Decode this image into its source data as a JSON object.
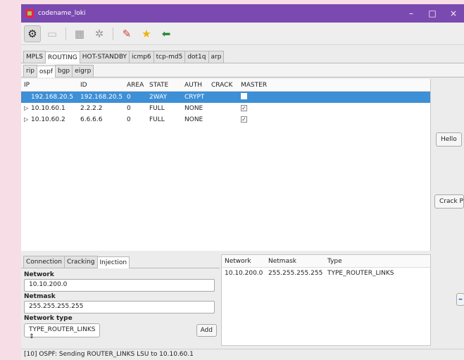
{
  "window": {
    "title": "codename_loki",
    "controls": [
      "–",
      "□",
      "×"
    ]
  },
  "toolbar": {
    "icons": [
      "gear-icon",
      "folder-icon",
      "users-icon",
      "network-icon",
      "edit-icon",
      "star-icon",
      "arrow-icon"
    ]
  },
  "protocol_tabs": [
    "MPLS",
    "ROUTING",
    "HOT-STANDBY",
    "icmp6",
    "tcp-md5",
    "dot1q",
    "arp"
  ],
  "routing_tabs": [
    "rip",
    "ospf",
    "bgp",
    "eigrp"
  ],
  "table": {
    "headers": [
      "IP",
      "ID",
      "AREA",
      "STATE",
      "AUTH",
      "CRACK",
      "MASTER"
    ],
    "rows": [
      {
        "ip": "192.168.20.5",
        "id": "192.168.20.5",
        "area": "0",
        "state": "2WAY",
        "auth": "CRYPT",
        "crack": "",
        "master": ""
      },
      {
        "ip": "10.10.60.1",
        "id": "2.2.2.2",
        "area": "0",
        "state": "FULL",
        "auth": "NONE",
        "crack": "",
        "master": "✓"
      },
      {
        "ip": "10.10.60.2",
        "id": "6.6.6.6",
        "area": "0",
        "state": "FULL",
        "auth": "NONE",
        "crack": "",
        "master": "✓"
      }
    ]
  },
  "side_buttons": {
    "hello": "Hello",
    "crack": "Crack PW"
  },
  "bottom_tabs": [
    "Connection",
    "Cracking",
    "Injection"
  ],
  "injection": {
    "network_label": "Network",
    "network_value": "10.10.200.0",
    "netmask_label": "Netmask",
    "netmask_value": "255.255.255.255",
    "network_type_label": "Network type",
    "network_type_value": "TYPE_ROUTER_LINKS",
    "add_label": "Add"
  },
  "network_table": {
    "headers": [
      "Network",
      "Netmask",
      "Type"
    ],
    "rows": [
      {
        "network": "10.10.200.0",
        "netmask": "255.255.255.255",
        "type": "TYPE_ROUTER_LINKS"
      }
    ]
  },
  "remove_label": "–",
  "status": "[10] OSPF: Sending ROUTER_LINKS LSU to 10.10.60.1"
}
